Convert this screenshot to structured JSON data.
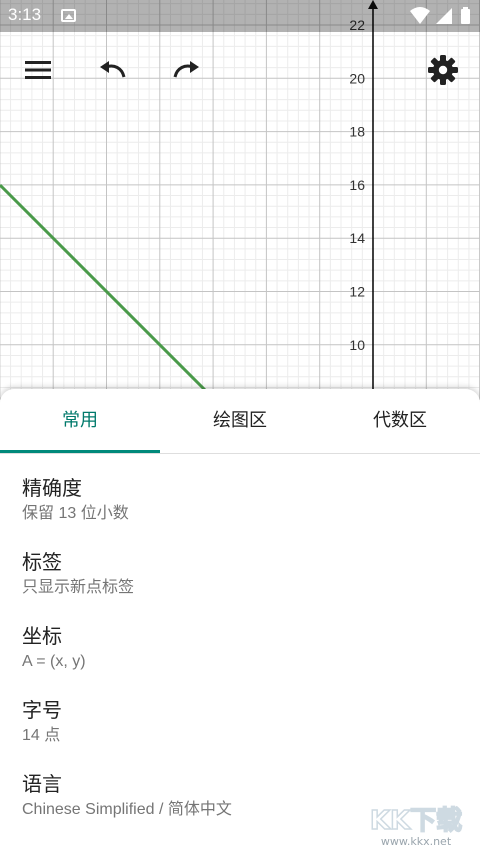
{
  "status_bar": {
    "time": "3:13"
  },
  "graph": {
    "y_axis_labels": [
      "22",
      "20",
      "18",
      "16",
      "14",
      "12",
      "10"
    ],
    "line_color": "#4a9a4a",
    "grid": true
  },
  "settings_panel": {
    "tabs": [
      {
        "label": "常用",
        "active": true
      },
      {
        "label": "绘图区",
        "active": false
      },
      {
        "label": "代数区",
        "active": false
      }
    ],
    "accent_color": "#00897b",
    "items": [
      {
        "title": "精确度",
        "value": "保留 13 位小数"
      },
      {
        "title": "标签",
        "value": "只显示新点标签"
      },
      {
        "title": "坐标",
        "value": "A = (x, y)"
      },
      {
        "title": "字号",
        "value": "14 点"
      },
      {
        "title": "语言",
        "value": "Chinese Simplified / 简体中文"
      }
    ]
  },
  "watermark": {
    "text": "KK下载",
    "url_text": "www.kkx.net"
  }
}
